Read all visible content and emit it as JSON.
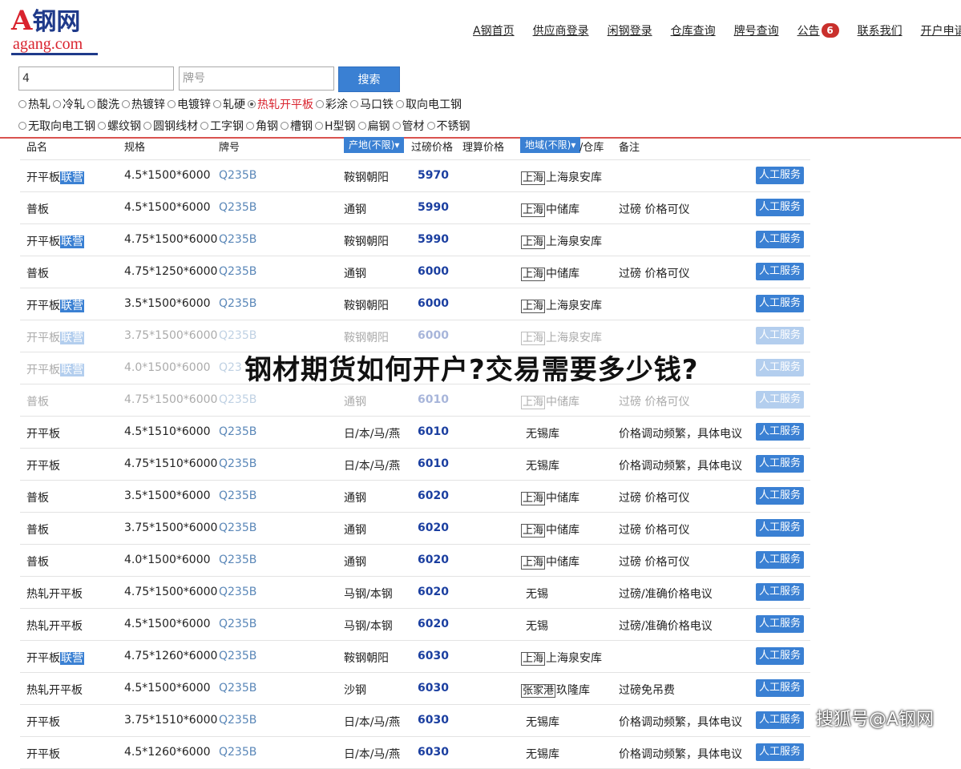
{
  "logo": {
    "brand_a": "A",
    "brand_cn": "钢网",
    "domain": "agang.com"
  },
  "nav": [
    {
      "label": "A钢首页"
    },
    {
      "label": "供应商登录"
    },
    {
      "label": "闲钢登录"
    },
    {
      "label": "仓库查询"
    },
    {
      "label": "牌号查询"
    },
    {
      "label": "公告",
      "badge": "6"
    },
    {
      "label": "联系我们"
    },
    {
      "label": "开户申请"
    }
  ],
  "search": {
    "spec_value": "4",
    "grade_placeholder": "牌号",
    "button": "搜索"
  },
  "categories_row1": [
    "热轧",
    "冷轧",
    "酸洗",
    "热镀锌",
    "电镀锌",
    "轧硬",
    "热轧开平板",
    "彩涂",
    "马口铁",
    "取向电工钢"
  ],
  "categories_row2": [
    "无取向电工钢",
    "螺纹钢",
    "圆钢线材",
    "工字钢",
    "角钢",
    "槽钢",
    "H型钢",
    "扁钢",
    "管材",
    "不锈钢"
  ],
  "selected_category": "热轧开平板",
  "table": {
    "headers": {
      "name": "品名",
      "spec": "规格",
      "grade": "牌号",
      "origin": "产地(不限)▾",
      "price_weigh": "过磅价格",
      "price_calc": "理算价格",
      "region": "地域(不限)▾",
      "warehouse": "/仓库",
      "note": "备注"
    },
    "service_label": "人工服务",
    "rows": [
      {
        "name": "开平板",
        "tag": "联营",
        "spec": "4.5*1500*6000",
        "grade": "Q235B",
        "origin": "鞍钢朝阳",
        "price": "5970",
        "region": "上海",
        "wh": "上海泉安库",
        "note": ""
      },
      {
        "name": "普板",
        "tag": "",
        "spec": "4.5*1500*6000",
        "grade": "Q235B",
        "origin": "通钢",
        "price": "5990",
        "region": "上海",
        "wh": "中储库",
        "note": "过磅 价格可仪"
      },
      {
        "name": "开平板",
        "tag": "联营",
        "spec": "4.75*1500*6000",
        "grade": "Q235B",
        "origin": "鞍钢朝阳",
        "price": "5990",
        "region": "上海",
        "wh": "上海泉安库",
        "note": ""
      },
      {
        "name": "普板",
        "tag": "",
        "spec": "4.75*1250*6000",
        "grade": "Q235B",
        "origin": "通钢",
        "price": "6000",
        "region": "上海",
        "wh": "中储库",
        "note": "过磅 价格可仪"
      },
      {
        "name": "开平板",
        "tag": "联营",
        "spec": "3.5*1500*6000",
        "grade": "Q235B",
        "origin": "鞍钢朝阳",
        "price": "6000",
        "region": "上海",
        "wh": "上海泉安库",
        "note": ""
      },
      {
        "name": "开平板",
        "tag": "联营",
        "spec": "3.75*1500*6000",
        "grade": "Q235B",
        "origin": "鞍钢朝阳",
        "price": "6000",
        "region": "上海",
        "wh": "上海泉安库",
        "note": "",
        "faded": true
      },
      {
        "name": "开平板",
        "tag": "联营",
        "spec": "4.0*1500*6000",
        "grade": "Q23",
        "origin": "",
        "price": "",
        "region": "",
        "wh": "",
        "note": "",
        "faded": true
      },
      {
        "name": "普板",
        "tag": "",
        "spec": "4.75*1500*6000",
        "grade": "Q235B",
        "origin": "通钢",
        "price": "6010",
        "region": "上海",
        "wh": "中储库",
        "note": "过磅 价格可仪",
        "faded": true
      },
      {
        "name": "开平板",
        "tag": "",
        "spec": "4.5*1510*6000",
        "grade": "Q235B",
        "origin": "日/本/马/燕",
        "price": "6010",
        "region": "",
        "wh": "无锡库",
        "note": "价格调动频繁，具体电议"
      },
      {
        "name": "开平板",
        "tag": "",
        "spec": "4.75*1510*6000",
        "grade": "Q235B",
        "origin": "日/本/马/燕",
        "price": "6010",
        "region": "",
        "wh": "无锡库",
        "note": "价格调动频繁，具体电议"
      },
      {
        "name": "普板",
        "tag": "",
        "spec": "3.5*1500*6000",
        "grade": "Q235B",
        "origin": "通钢",
        "price": "6020",
        "region": "上海",
        "wh": "中储库",
        "note": "过磅 价格可仪"
      },
      {
        "name": "普板",
        "tag": "",
        "spec": "3.75*1500*6000",
        "grade": "Q235B",
        "origin": "通钢",
        "price": "6020",
        "region": "上海",
        "wh": "中储库",
        "note": "过磅 价格可仪"
      },
      {
        "name": "普板",
        "tag": "",
        "spec": "4.0*1500*6000",
        "grade": "Q235B",
        "origin": "通钢",
        "price": "6020",
        "region": "上海",
        "wh": "中储库",
        "note": "过磅 价格可仪"
      },
      {
        "name": "热轧开平板",
        "tag": "",
        "spec": "4.75*1500*6000",
        "grade": "Q235B",
        "origin": "马钢/本钢",
        "price": "6020",
        "region": "",
        "wh": "无锡",
        "note": "过磅/准确价格电议"
      },
      {
        "name": "热轧开平板",
        "tag": "",
        "spec": "4.5*1500*6000",
        "grade": "Q235B",
        "origin": "马钢/本钢",
        "price": "6020",
        "region": "",
        "wh": "无锡",
        "note": "过磅/准确价格电议"
      },
      {
        "name": "开平板",
        "tag": "联营",
        "spec": "4.75*1260*6000",
        "grade": "Q235B",
        "origin": "鞍钢朝阳",
        "price": "6030",
        "region": "上海",
        "wh": "上海泉安库",
        "note": ""
      },
      {
        "name": "热轧开平板",
        "tag": "",
        "spec": "4.5*1500*6000",
        "grade": "Q235B",
        "origin": "沙钢",
        "price": "6030",
        "region": "张家港",
        "wh": "玖隆库",
        "note": "过磅免吊费"
      },
      {
        "name": "开平板",
        "tag": "",
        "spec": "3.75*1510*6000",
        "grade": "Q235B",
        "origin": "日/本/马/燕",
        "price": "6030",
        "region": "",
        "wh": "无锡库",
        "note": "价格调动频繁，具体电议"
      },
      {
        "name": "开平板",
        "tag": "",
        "spec": "4.5*1260*6000",
        "grade": "Q235B",
        "origin": "日/本/马/燕",
        "price": "6030",
        "region": "",
        "wh": "无锡库",
        "note": "价格调动频繁，具体电议"
      }
    ]
  },
  "overlay_title": "钢材期货如何开户?交易需要多少钱?",
  "watermark": "搜狐号@A钢网"
}
